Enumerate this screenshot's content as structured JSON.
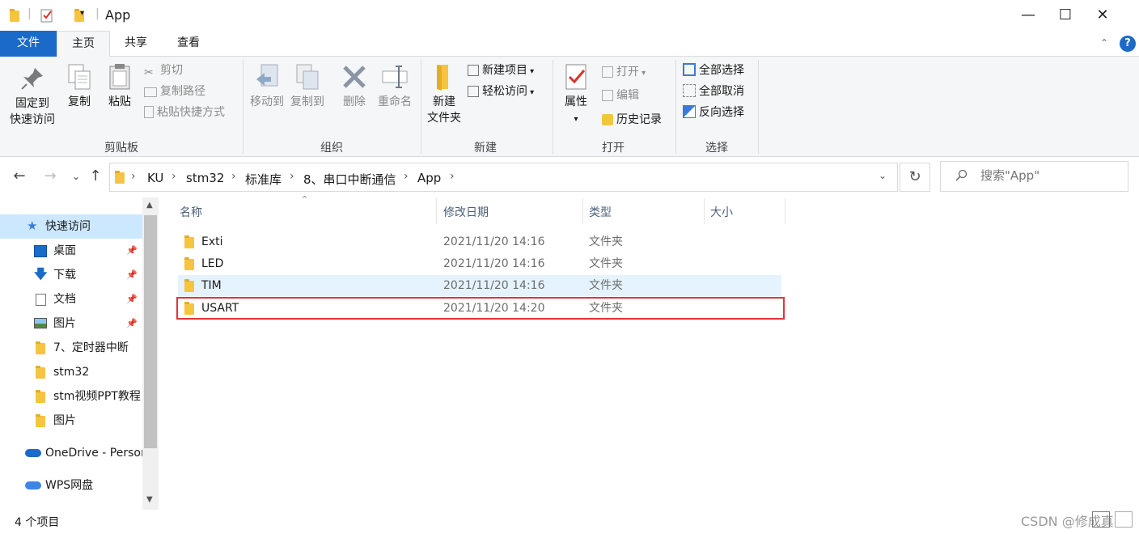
{
  "window": {
    "title": "App",
    "minimize": "—",
    "maximize": "☐",
    "close": "✕"
  },
  "tabs": [
    {
      "label": "文件"
    },
    {
      "label": "主页"
    },
    {
      "label": "共享"
    },
    {
      "label": "查看"
    }
  ],
  "help": "?",
  "ribbon": {
    "clipboard": {
      "group_label": "剪贴板",
      "pin_line1": "固定到",
      "pin_line2": "快速访问",
      "copy": "复制",
      "paste": "粘贴",
      "cut": "剪切",
      "copy_path": "复制路径",
      "paste_shortcut": "粘贴快捷方式"
    },
    "organize": {
      "group_label": "组织",
      "move_to": "移动到",
      "copy_to": "复制到",
      "delete": "删除",
      "rename": "重命名"
    },
    "new": {
      "group_label": "新建",
      "new_folder_line1": "新建",
      "new_folder_line2": "文件夹",
      "new_item": "新建项目",
      "easy_access": "轻松访问"
    },
    "open": {
      "group_label": "打开",
      "properties": "属性",
      "open": "打开",
      "edit": "编辑",
      "history": "历史记录"
    },
    "select": {
      "group_label": "选择",
      "select_all": "全部选择",
      "select_none": "全部取消",
      "invert": "反向选择"
    }
  },
  "breadcrumb": [
    "KU",
    "stm32",
    "标准库",
    "8、串口中断通信",
    "App"
  ],
  "search": {
    "placeholder": "搜索\"App\""
  },
  "sidebar": {
    "items": [
      {
        "label": "快速访问",
        "icon": "star-icon",
        "pinned": false
      },
      {
        "label": "桌面",
        "icon": "desktop-icon",
        "pinned": true
      },
      {
        "label": "下载",
        "icon": "download-icon",
        "pinned": true
      },
      {
        "label": "文档",
        "icon": "document-icon",
        "pinned": true
      },
      {
        "label": "图片",
        "icon": "picture-icon",
        "pinned": true
      },
      {
        "label": "7、定时器中断",
        "icon": "folder-icon",
        "pinned": false
      },
      {
        "label": "stm32",
        "icon": "folder-icon",
        "pinned": false
      },
      {
        "label": "stm视频PPT教程",
        "icon": "folder-icon",
        "pinned": false
      },
      {
        "label": "图片",
        "icon": "folder-icon",
        "pinned": false
      },
      {
        "label": "OneDrive - Personal",
        "icon": "onedrive-icon",
        "pinned": false
      },
      {
        "label": "WPS网盘",
        "icon": "wps-cloud-icon",
        "pinned": false
      }
    ]
  },
  "columns": [
    "名称",
    "修改日期",
    "类型",
    "大小"
  ],
  "files": [
    {
      "name": "Exti",
      "date": "2021/11/20 14:16",
      "type": "文件夹",
      "size": ""
    },
    {
      "name": "LED",
      "date": "2021/11/20 14:16",
      "type": "文件夹",
      "size": ""
    },
    {
      "name": "TIM",
      "date": "2021/11/20 14:16",
      "type": "文件夹",
      "size": ""
    },
    {
      "name": "USART",
      "date": "2021/11/20 14:20",
      "type": "文件夹",
      "size": ""
    }
  ],
  "status": {
    "item_count": "4 个项目"
  },
  "watermark": "CSDN @修成真",
  "colors": {
    "accent": "#1b6ac9",
    "highlight_box": "#e0343a",
    "hover_row": "#e5f3ff",
    "selected_nav": "#cce8ff"
  }
}
